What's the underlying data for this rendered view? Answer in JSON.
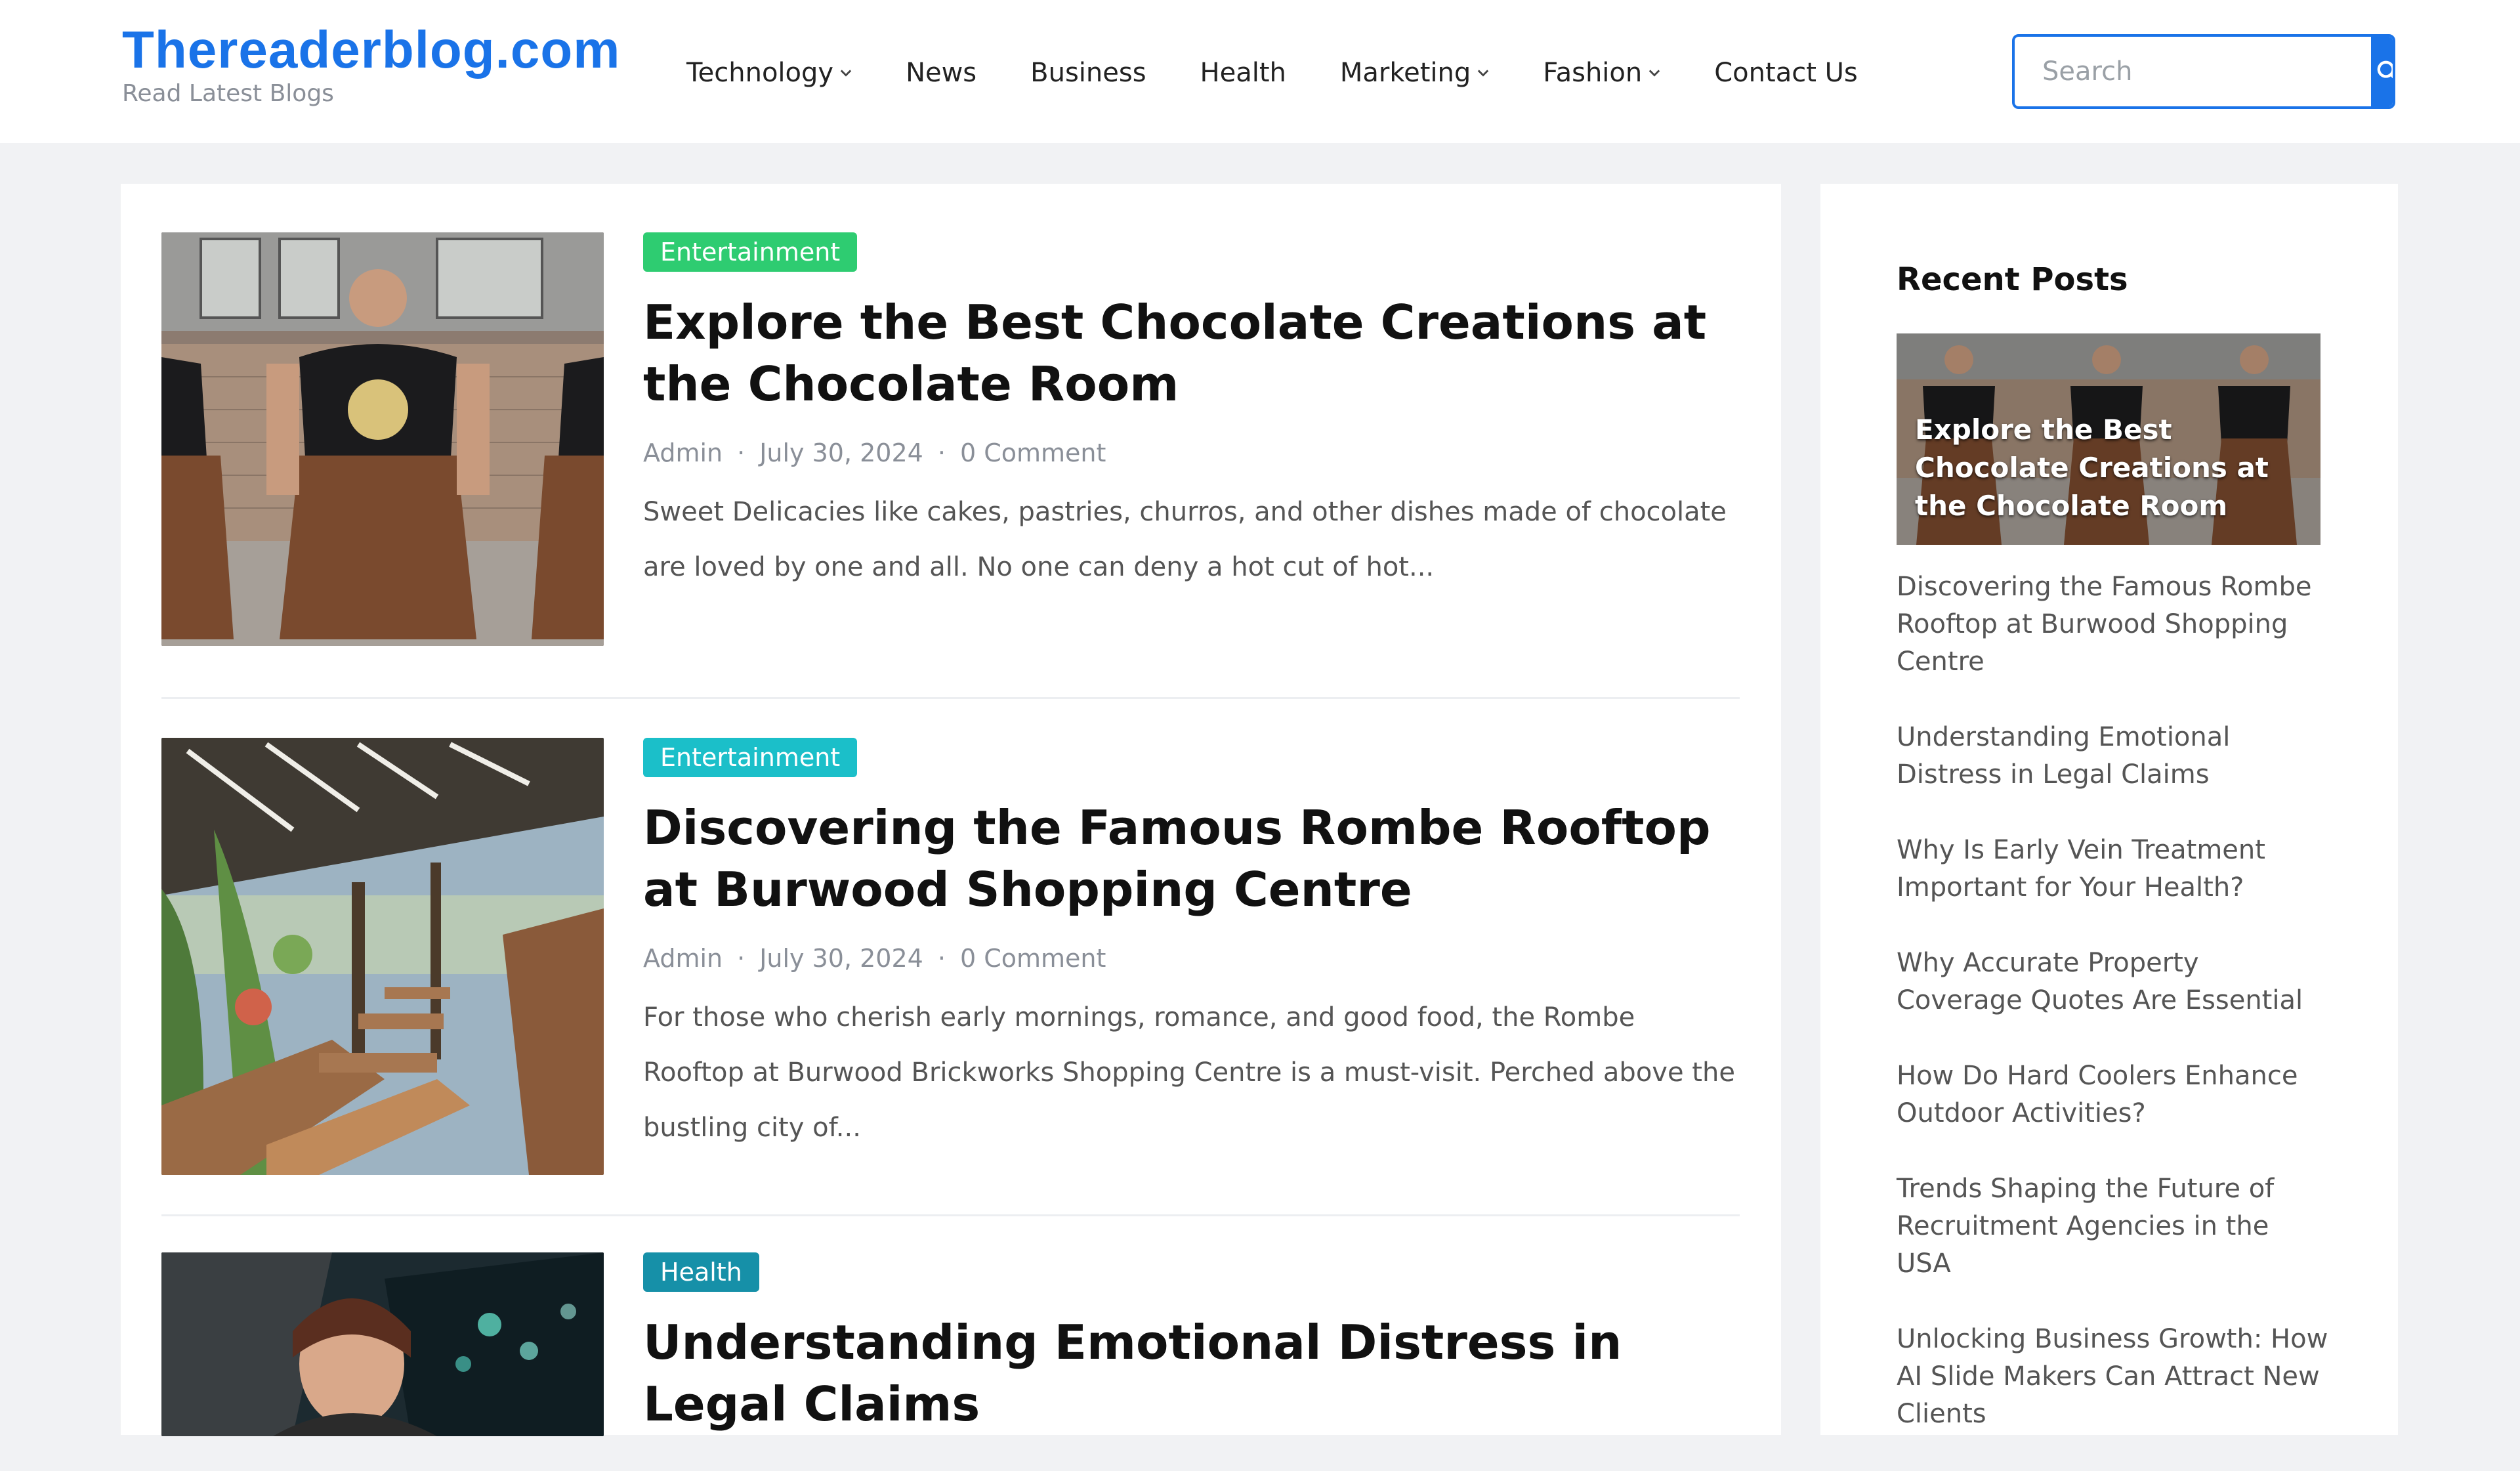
{
  "site": {
    "title": "Thereaderblog.com",
    "tagline": "Read Latest Blogs"
  },
  "nav": [
    {
      "label": "Technology",
      "dropdown": true
    },
    {
      "label": "News",
      "dropdown": false
    },
    {
      "label": "Business",
      "dropdown": false
    },
    {
      "label": "Health",
      "dropdown": false
    },
    {
      "label": "Marketing",
      "dropdown": true
    },
    {
      "label": "Fashion",
      "dropdown": true
    },
    {
      "label": "Contact Us",
      "dropdown": false
    }
  ],
  "search": {
    "placeholder": "Search",
    "icon": "search-icon"
  },
  "colors": {
    "accent": "#1a73e8",
    "badge_green": "#2ecc71",
    "badge_cyan": "#1bbfc9",
    "badge_teal": "#1690a8"
  },
  "posts": [
    {
      "category": "Entertainment",
      "title": "Explore the Best Chocolate Creations at the Chocolate Room",
      "author": "Admin",
      "date": "July 30, 2024",
      "comments": "0 Comment",
      "excerpt": "Sweet Delicacies like cakes, pastries, churros, and other dishes made of chocolate are loved by one and all. No one can deny a hot cut of hot..."
    },
    {
      "category": "Entertainment",
      "title": "Discovering the Famous Rombe Rooftop at Burwood Shopping Centre",
      "author": "Admin",
      "date": "July 30, 2024",
      "comments": "0 Comment",
      "excerpt": "For those who cherish early mornings, romance, and good food, the Rombe Rooftop at Burwood Brickworks Shopping Centre is a must-visit. Perched above the bustling city of..."
    },
    {
      "category": "Health",
      "title": "Understanding Emotional Distress in Legal Claims"
    }
  ],
  "sidebar": {
    "title": "Recent Posts",
    "featured_caption": "Explore the Best Chocolate Creations at the Chocolate Room",
    "items": [
      "Discovering the Famous Rombe Rooftop at Burwood Shopping Centre",
      "Understanding Emotional Distress in Legal Claims",
      "Why Is Early Vein Treatment Important for Your Health?",
      "Why Accurate Property Coverage Quotes Are Essential",
      "How Do Hard Coolers Enhance Outdoor Activities?",
      "Trends Shaping the Future of Recruitment Agencies in the USA",
      "Unlocking Business Growth: How AI Slide Makers Can Attract New Clients"
    ]
  }
}
